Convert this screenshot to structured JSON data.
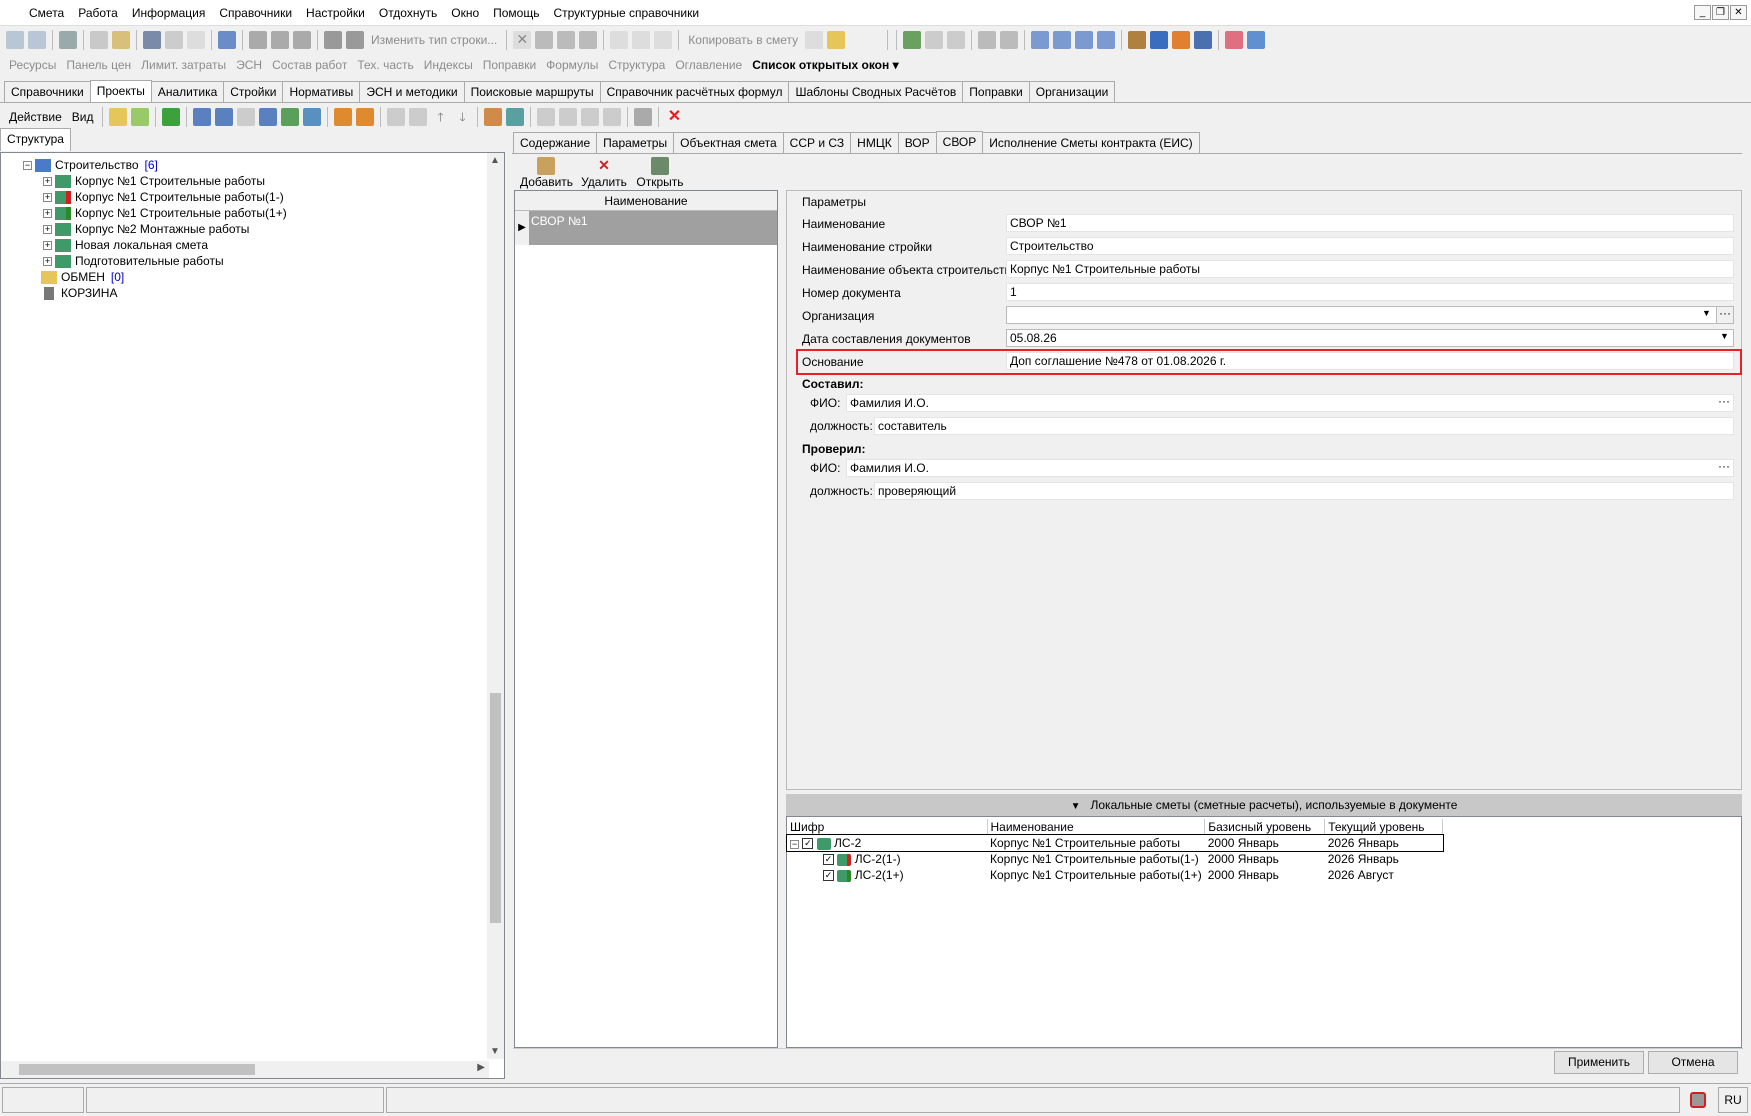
{
  "menu": [
    "Смета",
    "Работа",
    "Информация",
    "Справочники",
    "Настройки",
    "Отдохнуть",
    "Окно",
    "Помощь",
    "Структурные справочники"
  ],
  "toolbar1": {
    "change_line_type": "Изменить тип строки...",
    "copy_to_estimate": "Копировать в смету"
  },
  "toolbar2": {
    "items": [
      "Ресурсы",
      "Панель цен",
      "Лимит. затраты",
      "ЭСН",
      "Состав работ",
      "Тех. часть",
      "Индексы",
      "Поправки",
      "Формулы",
      "Структура",
      "Оглавление"
    ],
    "open_windows": "Список открытых окон"
  },
  "main_tabs": [
    "Справочники",
    "Проекты",
    "Аналитика",
    "Стройки",
    "Нормативы",
    "ЭСН и методики",
    "Поисковые маршруты",
    "Справочник расчётных формул",
    "Шаблоны Сводных Расчётов",
    "Поправки",
    "Организации"
  ],
  "action_bar": {
    "action": "Действие",
    "view": "Вид"
  },
  "left": {
    "tab": "Структура",
    "root": {
      "label": "Строительство",
      "count": "[6]"
    },
    "children": [
      "Корпус №1 Строительные работы",
      "Корпус №1 Строительные работы(1-)",
      "Корпус №1 Строительные работы(1+)",
      "Корпус №2 Монтажные работы",
      "Новая локальная смета",
      "Подготовительные работы"
    ],
    "exchange": {
      "label": "ОБМЕН",
      "count": "[0]"
    },
    "trash": "КОРЗИНА"
  },
  "doc_tabs": [
    "Содержание",
    "Параметры",
    "Объектная смета",
    "ССР и СЗ",
    "НМЦК",
    "ВОР",
    "СВОР",
    "Исполнение Сметы контракта (ЕИС)"
  ],
  "actions": {
    "add": "Добавить",
    "delete": "Удалить",
    "open": "Открыть"
  },
  "list": {
    "header": "Наименование",
    "rows": [
      "СВОР №1"
    ]
  },
  "params": {
    "group": "Параметры",
    "fields": [
      {
        "label": "Наименование",
        "value": "СВОР №1"
      },
      {
        "label": "Наименование стройки",
        "value": "Строительство"
      },
      {
        "label": "Наименование объекта строительства",
        "value": "Корпус №1 Строительные работы"
      },
      {
        "label": "Номер документа",
        "value": "1"
      },
      {
        "label": "Организация",
        "value": ""
      },
      {
        "label": "Дата составления документов",
        "value": "05.08.26"
      },
      {
        "label": "Основание",
        "value": "Доп соглашение №478 от 01.08.2026 г."
      }
    ],
    "composed": {
      "title": "Составил:",
      "fio_label": "ФИО:",
      "fio": "Фамилия И.О.",
      "pos_label": "должность:",
      "pos": "составитель"
    },
    "checked": {
      "title": "Проверил:",
      "fio_label": "ФИО:",
      "fio": "Фамилия И.О.",
      "pos_label": "должность:",
      "pos": "проверяющий"
    }
  },
  "local": {
    "title": "Локальные сметы (сметные расчеты), используемые в документе",
    "headers": [
      "Шифр",
      "Наименование",
      "Базисный уровень",
      "Текущий уровень"
    ],
    "rows": [
      {
        "code": "ЛС-2",
        "name": "Корпус №1 Строительные работы",
        "base": "2000 Январь",
        "cur": "2026 Январь"
      },
      {
        "code": "ЛС-2(1-)",
        "name": "Корпус №1 Строительные работы(1-)",
        "base": "2000 Январь",
        "cur": "2026 Январь"
      },
      {
        "code": "ЛС-2(1+)",
        "name": "Корпус №1 Строительные работы(1+)",
        "base": "2000 Январь",
        "cur": "2026 Август"
      }
    ]
  },
  "buttons": {
    "apply": "Применить",
    "cancel": "Отмена"
  },
  "status": {
    "lang": "RU"
  },
  "colors": {
    "highlight": "#e8202a",
    "selected_row": "#a0a0a0",
    "link_blue": "#0000cc"
  }
}
